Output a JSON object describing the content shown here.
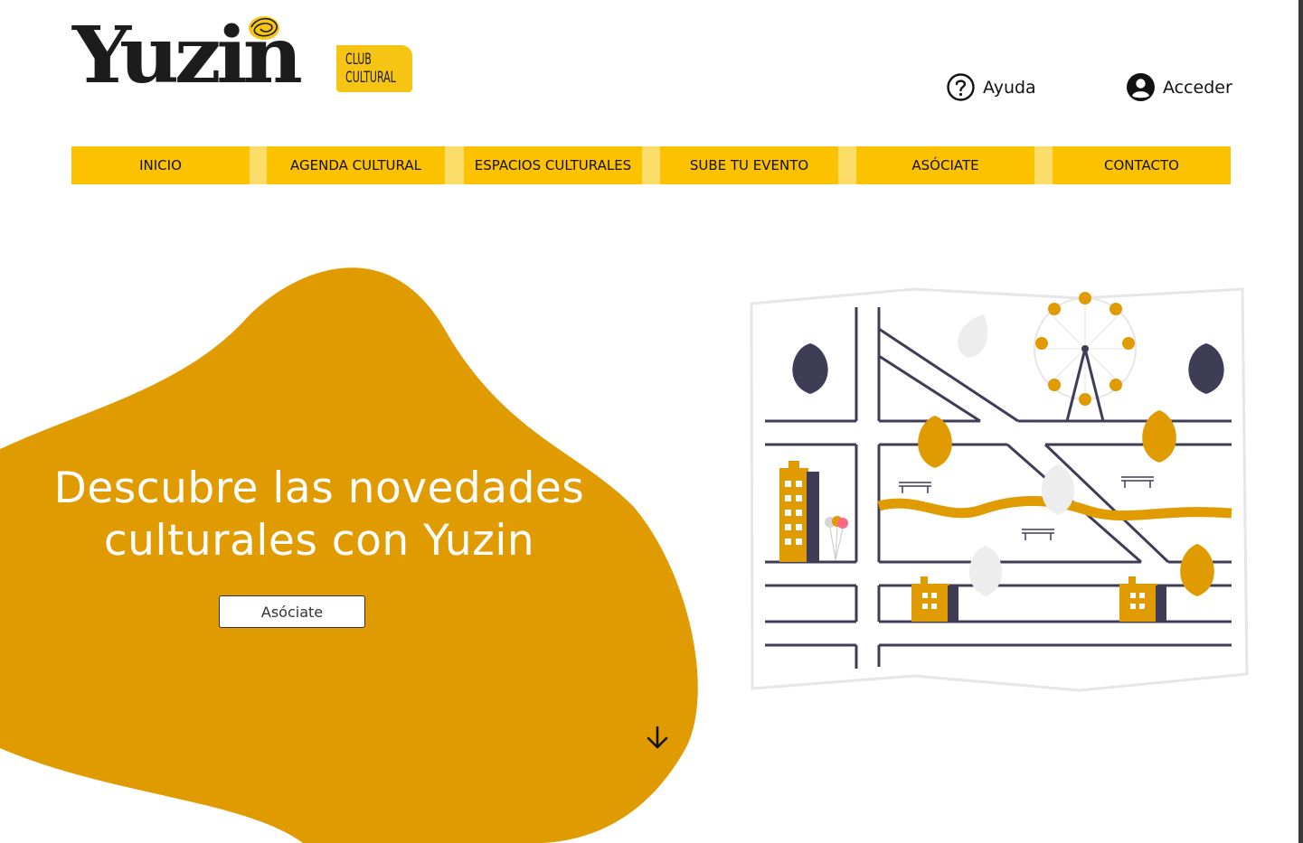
{
  "brand": {
    "name": "Yuzin",
    "tag_line1": "CLUB",
    "tag_line2": "CULTURAL",
    "accent_color": "#f6c412",
    "dark_color": "#1c1c1c"
  },
  "header": {
    "help": {
      "label": "Ayuda",
      "icon": "question-circle-icon"
    },
    "login": {
      "label": "Acceder",
      "icon": "user-circle-icon"
    }
  },
  "nav": {
    "items": [
      {
        "label": "INICIO"
      },
      {
        "label": "AGENDA CULTURAL"
      },
      {
        "label": "ESPACIOS CULTURALES"
      },
      {
        "label": "SUBE TU EVENTO"
      },
      {
        "label": "ASÓCIATE"
      },
      {
        "label": "CONTACTO"
      }
    ],
    "background": "#fcc200",
    "separator": "#fcdd6a"
  },
  "hero": {
    "title_line1": "Descubre las novedades",
    "title_line2": "culturales con Yuzin",
    "cta_label": "Asóciate",
    "blob_color": "#e09b00",
    "scroll_icon": "arrow-down-icon"
  },
  "illustration": {
    "subject": "city-map-illustration",
    "colors": {
      "accent": "#e09b00",
      "dark": "#3f3d56",
      "light": "#f2f2f2"
    }
  }
}
